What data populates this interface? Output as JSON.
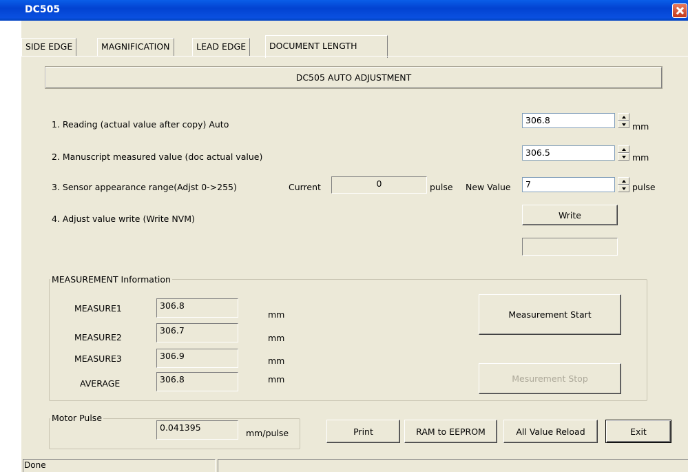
{
  "window": {
    "title": "DC505"
  },
  "tabs": [
    {
      "label": "SIDE EDGE"
    },
    {
      "label": "MAGNIFICATION"
    },
    {
      "label": "LEAD EDGE"
    },
    {
      "label": "DOCUMENT LENGTH",
      "active": true
    }
  ],
  "banner": "DC505 AUTO ADJUSTMENT",
  "rows": {
    "reading": {
      "label": "1. Reading (actual value after copy) Auto",
      "value": "306.8",
      "unit": "mm"
    },
    "manuscript": {
      "label": "2. Manuscript measured value (doc actual value)",
      "value": "306.5",
      "unit": "mm"
    },
    "sensor": {
      "label": "3. Sensor appearance range(Adjst 0->255)",
      "current_label": "Current",
      "current_value": "0",
      "current_unit": "pulse",
      "new_label": "New Value",
      "new_value": "7",
      "new_unit": "pulse"
    },
    "write": {
      "label": "4. Adjust value write (Write NVM)",
      "button": "Write",
      "status": ""
    }
  },
  "measurement": {
    "title": "MEASUREMENT Information",
    "items": [
      {
        "label": "MEASURE1",
        "value": "306.8",
        "unit": "mm"
      },
      {
        "label": "MEASURE2",
        "value": "306.7",
        "unit": "mm"
      },
      {
        "label": "MEASURE3",
        "value": "306.9",
        "unit": "mm"
      },
      {
        "label": "AVERAGE",
        "value": "306.8",
        "unit": "mm"
      }
    ],
    "start_button": "Measurement Start",
    "stop_button": "Mesurement Stop"
  },
  "motor": {
    "title": "Motor Pulse",
    "value": "0.041395",
    "unit": "mm/pulse"
  },
  "buttons": {
    "print": "Print",
    "ram_to_eeprom": "RAM to EEPROM",
    "reload": "All Value Reload",
    "exit": "Exit"
  },
  "status_bar": {
    "text": "Done"
  },
  "colors": {
    "titlebar": "#0a50e0",
    "face": "#ece9d8",
    "disabled_text": "#aca899"
  }
}
